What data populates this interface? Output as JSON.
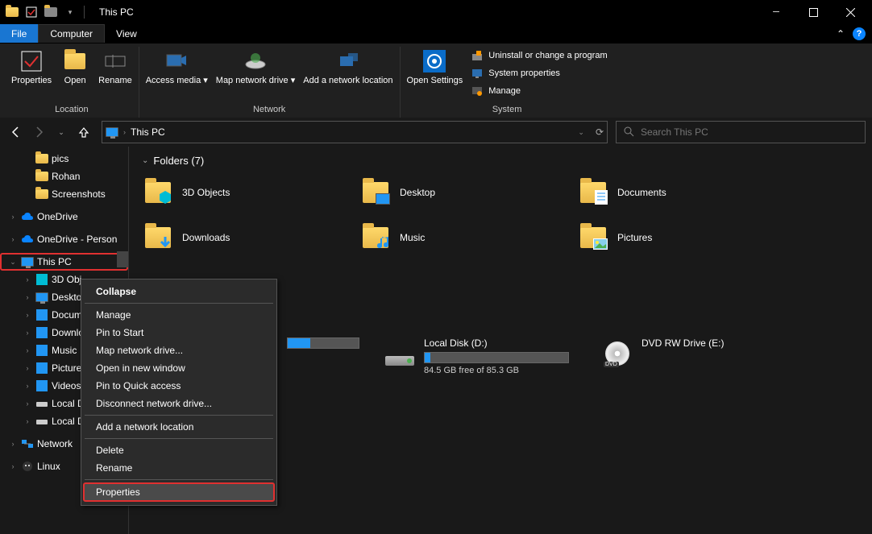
{
  "window": {
    "title": "This PC"
  },
  "tabs": {
    "file": "File",
    "computer": "Computer",
    "view": "View"
  },
  "ribbon": {
    "location": {
      "label": "Location",
      "properties": "Properties",
      "open": "Open",
      "rename": "Rename"
    },
    "network": {
      "label": "Network",
      "access_media": "Access media ▾",
      "map_drive": "Map network drive ▾",
      "add_location": "Add a network location"
    },
    "settings": {
      "open_settings": "Open Settings"
    },
    "system": {
      "label": "System",
      "uninstall": "Uninstall or change a program",
      "sysprops": "System properties",
      "manage": "Manage"
    }
  },
  "address": {
    "crumb": "This PC"
  },
  "search": {
    "placeholder": "Search This PC"
  },
  "sidebar": {
    "items": [
      {
        "label": "pics",
        "type": "folder",
        "level": 2
      },
      {
        "label": "Rohan",
        "type": "folder",
        "level": 2
      },
      {
        "label": "Screenshots",
        "type": "folder",
        "level": 2
      },
      {
        "spacer": true
      },
      {
        "label": "OneDrive",
        "type": "cloud",
        "level": 1,
        "chev": "›"
      },
      {
        "spacer": true
      },
      {
        "label": "OneDrive - Person",
        "type": "cloud",
        "level": 1,
        "chev": "›"
      },
      {
        "spacer": true
      },
      {
        "label": "This PC",
        "type": "pc",
        "level": 1,
        "chev": "⌄",
        "highlighted": true
      },
      {
        "label": "3D Obj",
        "type": "3d",
        "level": 2,
        "chev": "›"
      },
      {
        "label": "Deskto",
        "type": "desktop",
        "level": 2,
        "chev": "›"
      },
      {
        "label": "Docum",
        "type": "docs",
        "level": 2,
        "chev": "›"
      },
      {
        "label": "Downlo",
        "type": "downloads",
        "level": 2,
        "chev": "›"
      },
      {
        "label": "Music",
        "type": "music",
        "level": 2,
        "chev": "›"
      },
      {
        "label": "Picture",
        "type": "pictures",
        "level": 2,
        "chev": "›"
      },
      {
        "label": "Videos",
        "type": "videos",
        "level": 2,
        "chev": "›"
      },
      {
        "label": "Local D",
        "type": "disk",
        "level": 2,
        "chev": "›"
      },
      {
        "label": "Local D",
        "type": "disk",
        "level": 2,
        "chev": "›"
      },
      {
        "spacer": true
      },
      {
        "label": "Network",
        "type": "network",
        "level": 1,
        "chev": "›"
      },
      {
        "spacer": true
      },
      {
        "label": "Linux",
        "type": "linux",
        "level": 1,
        "chev": "›"
      }
    ]
  },
  "folders": {
    "header": "Folders (7)",
    "items": [
      {
        "label": "3D Objects",
        "icon": "3d"
      },
      {
        "label": "Desktop",
        "icon": "desktop"
      },
      {
        "label": "Documents",
        "icon": "docs"
      },
      {
        "label": "Downloads",
        "icon": "downloads"
      },
      {
        "label": "Music",
        "icon": "music"
      },
      {
        "label": "Pictures",
        "icon": "pictures"
      }
    ]
  },
  "drives": [
    {
      "label": "Local Disk (D:)",
      "free": "84.5 GB free of 85.3 GB",
      "fill": 4,
      "icon": "hdd"
    },
    {
      "label": "DVD RW Drive (E:)",
      "free": "",
      "fill": 0,
      "icon": "dvd"
    }
  ],
  "partial_drive": {
    "fill": 32
  },
  "ctx": {
    "items": [
      {
        "label": "Collapse",
        "bold": true
      },
      {
        "sep": true
      },
      {
        "label": "Manage"
      },
      {
        "label": "Pin to Start"
      },
      {
        "label": "Map network drive..."
      },
      {
        "label": "Open in new window"
      },
      {
        "label": "Pin to Quick access"
      },
      {
        "label": "Disconnect network drive..."
      },
      {
        "sep": true
      },
      {
        "label": "Add a network location"
      },
      {
        "sep": true
      },
      {
        "label": "Delete"
      },
      {
        "label": "Rename"
      },
      {
        "sep": true
      },
      {
        "label": "Properties",
        "highlighted": true,
        "hover": true
      }
    ]
  }
}
